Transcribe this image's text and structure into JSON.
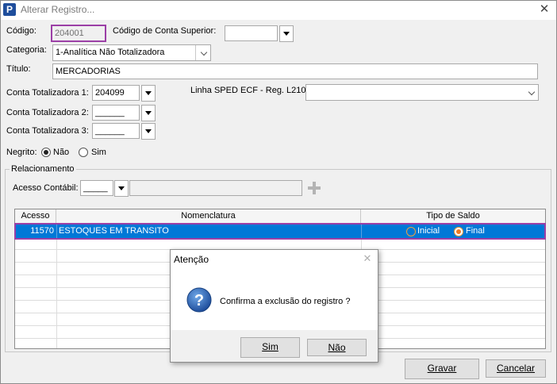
{
  "window": {
    "title": "Alterar Registro...",
    "app_icon_label": "P"
  },
  "form": {
    "codigo_label": "Código:",
    "codigo_value": "204001",
    "conta_superior_label": "Código de Conta Superior:",
    "conta_superior_value": "",
    "categoria_label": "Categoria:",
    "categoria_value": "1-Analítica Não Totalizadora",
    "titulo_label": "Título:",
    "titulo_value": "MERCADORIAS",
    "tot1_label": "Conta Totalizadora 1:",
    "tot1_value": "204099",
    "tot2_label": "Conta Totalizadora 2:",
    "tot2_value": "______",
    "tot3_label": "Conta Totalizadora 3:",
    "tot3_value": "______",
    "sped_label": "Linha SPED ECF - Reg. L210:",
    "sped_value": "",
    "negrito_label": "Negrito:",
    "negrito_options": [
      "Não",
      "Sim"
    ],
    "negrito_selected": "Não"
  },
  "relacionamento": {
    "group_label": "Relacionamento",
    "acesso_label": "Acesso Contábil:",
    "acesso_value": "_____",
    "add_icon": "plus-icon",
    "columns": [
      "Acesso",
      "Nomenclatura",
      "Tipo de Saldo"
    ],
    "rows": [
      {
        "acesso": "11570",
        "nomenclatura": "ESTOQUES EM TRANSITO",
        "saldo_options": [
          "Inicial",
          "Final"
        ],
        "saldo_selected": "Final"
      }
    ]
  },
  "dialog": {
    "title": "Atenção",
    "message": "Confirma a exclusão do registro ?",
    "icon": "question-icon",
    "yes_label": "Sim",
    "no_label": "Não"
  },
  "buttons": {
    "gravar_label": "Gravar",
    "cancelar_label": "Cancelar"
  },
  "colors": {
    "highlight": "#9b3fa6",
    "selection": "#0078d7",
    "icon_blue": "#1f4e9c"
  }
}
